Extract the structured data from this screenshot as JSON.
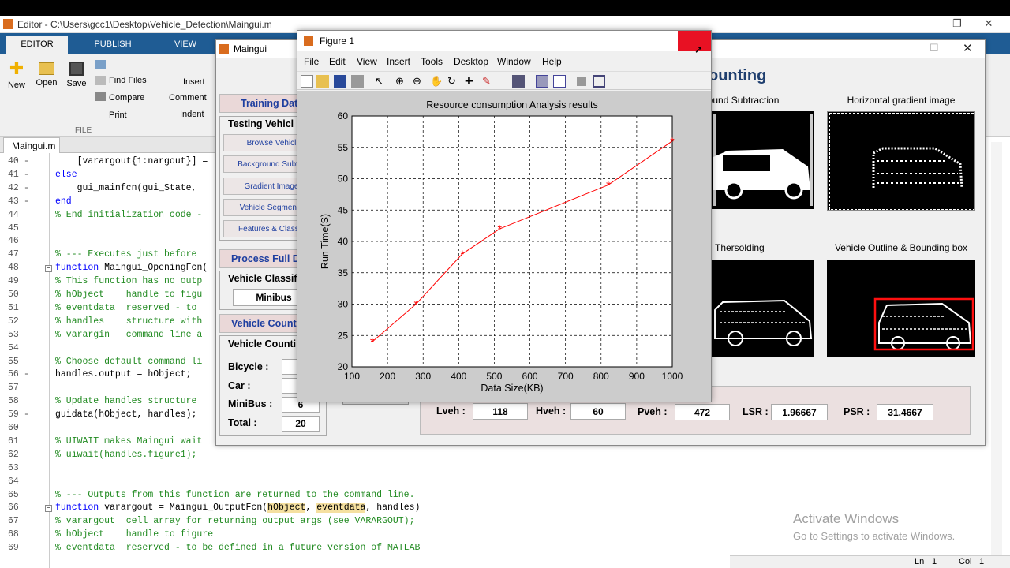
{
  "editor": {
    "title": "Editor - C:\\Users\\gcc1\\Desktop\\Vehicle_Detection\\Maingui.m",
    "tabs": [
      "EDITOR",
      "PUBLISH",
      "VIEW"
    ],
    "ribbon": {
      "new": "New",
      "open": "Open",
      "save": "Save",
      "find_files": "Find Files",
      "compare": "Compare",
      "print": "Print",
      "insert": "Insert",
      "comment": "Comment",
      "indent": "Indent",
      "section_file": "FILE"
    },
    "file_tab": "Maingui.m",
    "code_lines": [
      {
        "n": "40",
        "m": "-",
        "t": "    [varargout{1:nargout}] = ",
        "c": "plain"
      },
      {
        "n": "41",
        "m": "-",
        "t": "else",
        "c": "kw"
      },
      {
        "n": "42",
        "m": "-",
        "t": "    gui_mainfcn(gui_State, ",
        "c": "plain"
      },
      {
        "n": "43",
        "m": "-",
        "t": "end",
        "c": "kw"
      },
      {
        "n": "44",
        "m": "",
        "t": "% End initialization code - ",
        "c": "cm"
      },
      {
        "n": "45",
        "m": "",
        "t": "",
        "c": "plain"
      },
      {
        "n": "46",
        "m": "",
        "t": "",
        "c": "plain"
      },
      {
        "n": "47",
        "m": "",
        "t": "% --- Executes just before ",
        "c": "cm"
      },
      {
        "n": "48",
        "m": "",
        "t": "function Maingui_OpeningFcn(",
        "c": "fn"
      },
      {
        "n": "49",
        "m": "",
        "t": "% This function has no outp",
        "c": "cm"
      },
      {
        "n": "50",
        "m": "",
        "t": "% hObject    handle to figu",
        "c": "cm"
      },
      {
        "n": "51",
        "m": "",
        "t": "% eventdata  reserved - to ",
        "c": "cm"
      },
      {
        "n": "52",
        "m": "",
        "t": "% handles    structure with",
        "c": "cm"
      },
      {
        "n": "53",
        "m": "",
        "t": "% varargin   command line a",
        "c": "cm"
      },
      {
        "n": "54",
        "m": "",
        "t": "",
        "c": "plain"
      },
      {
        "n": "55",
        "m": "",
        "t": "% Choose default command li",
        "c": "cm"
      },
      {
        "n": "56",
        "m": "-",
        "t": "handles.output = hObject;",
        "c": "plain"
      },
      {
        "n": "57",
        "m": "",
        "t": "",
        "c": "plain"
      },
      {
        "n": "58",
        "m": "",
        "t": "% Update handles structure ",
        "c": "cm"
      },
      {
        "n": "59",
        "m": "-",
        "t": "guidata(hObject, handles);",
        "c": "plain"
      },
      {
        "n": "60",
        "m": "",
        "t": "",
        "c": "plain"
      },
      {
        "n": "61",
        "m": "",
        "t": "% UIWAIT makes Maingui wait",
        "c": "cm"
      },
      {
        "n": "62",
        "m": "",
        "t": "% uiwait(handles.figure1);",
        "c": "cm"
      },
      {
        "n": "63",
        "m": "",
        "t": "",
        "c": "plain"
      },
      {
        "n": "64",
        "m": "",
        "t": "",
        "c": "plain"
      },
      {
        "n": "65",
        "m": "",
        "t": "% --- Outputs from this function are returned to the command line.",
        "c": "cm"
      },
      {
        "n": "66",
        "m": "",
        "t": "function varargout = Maingui_OutputFcn(hObject, eventdata, handles)",
        "c": "fn2"
      },
      {
        "n": "67",
        "m": "",
        "t": "% varargout  cell array for returning output args (see VARARGOUT);",
        "c": "cm"
      },
      {
        "n": "68",
        "m": "",
        "t": "% hObject    handle to figure",
        "c": "cm"
      },
      {
        "n": "69",
        "m": "",
        "t": "% eventdata  reserved - to be defined in a future version of MATLAB",
        "c": "cm"
      }
    ],
    "status": {
      "ln_label": "Ln",
      "ln": "1",
      "col_label": "Col",
      "col": "1"
    }
  },
  "watermark": {
    "line1": "Activate Windows",
    "line2": "Go to Settings to activate Windows."
  },
  "maingui": {
    "title": "Maingui",
    "heading_partial": "ounting",
    "training_header": "Training Dat",
    "testing_title": "Testing Vehicl",
    "testing_buttons": [
      "Browse Vehicl",
      "Background Subtra",
      "Gradient Image",
      "Vehicle Segmenta",
      "Features & Classifi"
    ],
    "process_full": "Process Full D",
    "classification_title": "Vehicle Classif",
    "classification_value": "Minibus",
    "vehicle_count_header": "Vehicle Count",
    "counting_title": "Vehicle Counti",
    "counts": [
      {
        "label": "Bicycle :",
        "value": ""
      },
      {
        "label": "Car :",
        "value": ""
      },
      {
        "label": "MiniBus :",
        "value": "6"
      },
      {
        "label": "Total  :",
        "value": "20"
      }
    ],
    "images": [
      {
        "caption": "ground Subtraction"
      },
      {
        "caption": "Horizontal gradient image"
      },
      {
        "caption": "Thersolding"
      },
      {
        "caption": "Vehicle Outline & Bounding box"
      }
    ],
    "metrics": [
      {
        "label": "Lveh :",
        "value": "118"
      },
      {
        "label": "Hveh :",
        "value": "60"
      },
      {
        "label": "Pveh :",
        "value": "472"
      },
      {
        "label": "LSR :",
        "value": "1.96667"
      },
      {
        "label": "PSR :",
        "value": "31.4667"
      }
    ]
  },
  "figure": {
    "title": "Figure 1",
    "menu": [
      "File",
      "Edit",
      "View",
      "Insert",
      "Tools",
      "Desktop",
      "Window",
      "Help"
    ]
  },
  "chart_data": {
    "type": "line",
    "title": "Resource consumption Analysis results",
    "xlabel": "Data Size(KB)",
    "ylabel": "Run Time(S)",
    "xlim": [
      100,
      1000
    ],
    "ylim": [
      20,
      60
    ],
    "xticks": [
      100,
      200,
      300,
      400,
      500,
      600,
      700,
      800,
      900,
      1000
    ],
    "yticks": [
      20,
      25,
      30,
      35,
      40,
      45,
      50,
      55,
      60
    ],
    "grid": true,
    "marker": "*",
    "color": "#ff0000",
    "x": [
      157,
      280,
      410,
      515,
      820,
      1000
    ],
    "y": [
      24,
      30,
      38,
      42,
      49,
      56
    ]
  }
}
